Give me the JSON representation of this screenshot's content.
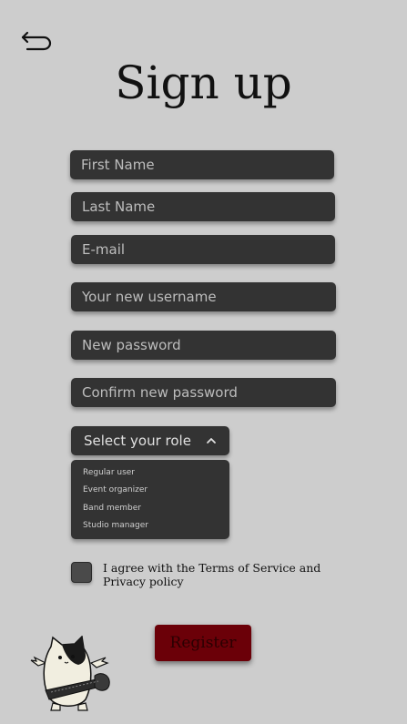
{
  "header": {
    "back_icon": "back-arrow-icon",
    "title": "Sign up"
  },
  "form": {
    "first_name_placeholder": "First Name",
    "last_name_placeholder": "Last Name",
    "email_placeholder": "E-mail",
    "username_placeholder": "Your new username",
    "password_placeholder": "New password",
    "confirm_password_placeholder": "Confirm new password",
    "role_select": {
      "label": "Select your role",
      "icon": "chevron-up-icon",
      "options": [
        "Regular user",
        "Event organizer",
        "Band member",
        "Studio manager"
      ]
    },
    "agree_text": "I agree with the Terms of Service and Privacy policy",
    "register_label": "Register"
  },
  "colors": {
    "background": "#cdcdcd",
    "field_background": "#333333",
    "register_button": "#6b0008"
  }
}
